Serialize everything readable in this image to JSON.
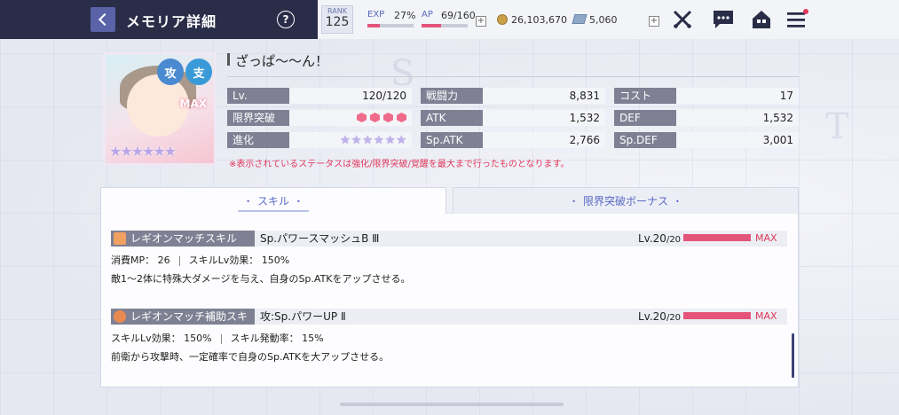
{
  "header": {
    "title": "メモリア詳細",
    "help": "?"
  },
  "status": {
    "rank_label": "RANK",
    "rank_value": "125",
    "exp_label": "EXP",
    "exp_value": "27%",
    "exp_fraction": 0.27,
    "ap_label": "AP",
    "ap_value": "69/160",
    "ap_fraction": 0.43,
    "plus": "+",
    "coins": "26,103,670",
    "gems": "5,060"
  },
  "memoria": {
    "name": "ざっぱ〜〜ん！",
    "max_label": "MAX",
    "badge1": "攻",
    "badge2": "支",
    "card_stars": "★★★★★★",
    "stats_left": [
      {
        "key": "Lv.",
        "value": "120/120"
      },
      {
        "key": "限界突破",
        "value": ""
      },
      {
        "key": "進化",
        "value": ""
      }
    ],
    "limit_break_count": 4,
    "evolution_stars": 6,
    "stats_mid": [
      {
        "key": "戦闘力",
        "value": "8,831"
      },
      {
        "key": "ATK",
        "value": "1,532"
      },
      {
        "key": "Sp.ATK",
        "value": "2,766"
      }
    ],
    "stats_right": [
      {
        "key": "コスト",
        "value": "17"
      },
      {
        "key": "DEF",
        "value": "1,532"
      },
      {
        "key": "Sp.DEF",
        "value": "3,001"
      }
    ],
    "note": "※表示されているステータスは強化/限界突破/覚醒を最大まで行ったものとなります。"
  },
  "tabs": [
    {
      "label": "スキル"
    },
    {
      "label": "限界突破ボーナス"
    }
  ],
  "skills": [
    {
      "type": "レギオンマッチスキル",
      "name": "Sp.パワースマッシュB Ⅲ",
      "lv": "Lv.20",
      "lv_max": "/20",
      "max": "MAX",
      "detail1a": "消費MP： 26",
      "detail1b": "スキルLv効果： 150%",
      "desc": "敵1〜2体に特殊大ダメージを与え、自身のSp.ATKをアップさせる。",
      "icon_color": "#f0a060"
    },
    {
      "type": "レギオンマッチ補助スキル",
      "name": "攻:Sp.パワーUP Ⅱ",
      "lv": "Lv.20",
      "lv_max": "/20",
      "max": "MAX",
      "detail1a": "スキルLv効果： 150%",
      "detail1b": "スキル発動率： 15%",
      "desc": "前衛から攻撃時、一定確率で自身のSp.ATKを大アップさせる。",
      "icon_color": "#f0a060"
    }
  ]
}
